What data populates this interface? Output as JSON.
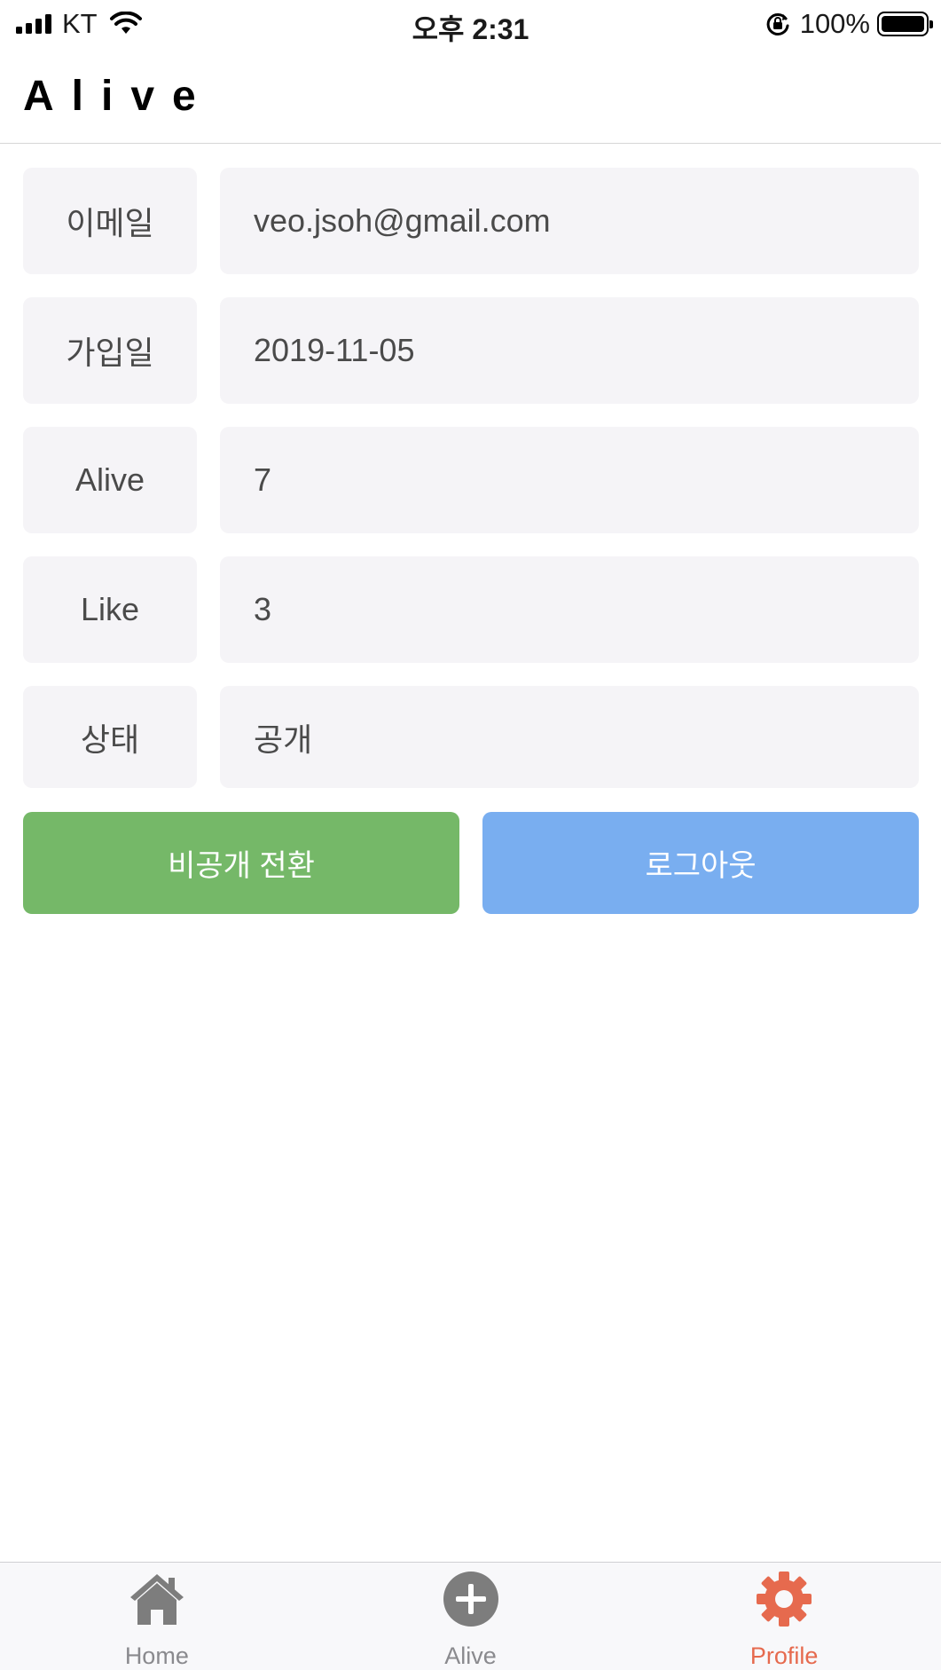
{
  "status_bar": {
    "carrier": "KT",
    "time": "오후 2:31",
    "battery": "100%",
    "battery_level": 1.0
  },
  "header": {
    "title": "Alive"
  },
  "profile": {
    "rows": [
      {
        "label": "이메일",
        "value": "veo.jsoh@gmail.com"
      },
      {
        "label": "가입일",
        "value": "2019-11-05"
      },
      {
        "label": "Alive",
        "value": "7"
      },
      {
        "label": "Like",
        "value": "3"
      },
      {
        "label": "상태",
        "value": "공개"
      }
    ]
  },
  "actions": {
    "toggle_private_label": "비공개 전환",
    "logout_label": "로그아웃",
    "toggle_color": "#75b868",
    "logout_color": "#79aef0"
  },
  "tab_bar": {
    "tabs": [
      {
        "label": "Home",
        "icon": "home-icon"
      },
      {
        "label": "Alive",
        "icon": "plus-circle-icon"
      },
      {
        "label": "Profile",
        "icon": "gear-icon",
        "active": true
      }
    ],
    "active_color": "#e66a4e",
    "inactive_color": "#7d7d7d"
  }
}
